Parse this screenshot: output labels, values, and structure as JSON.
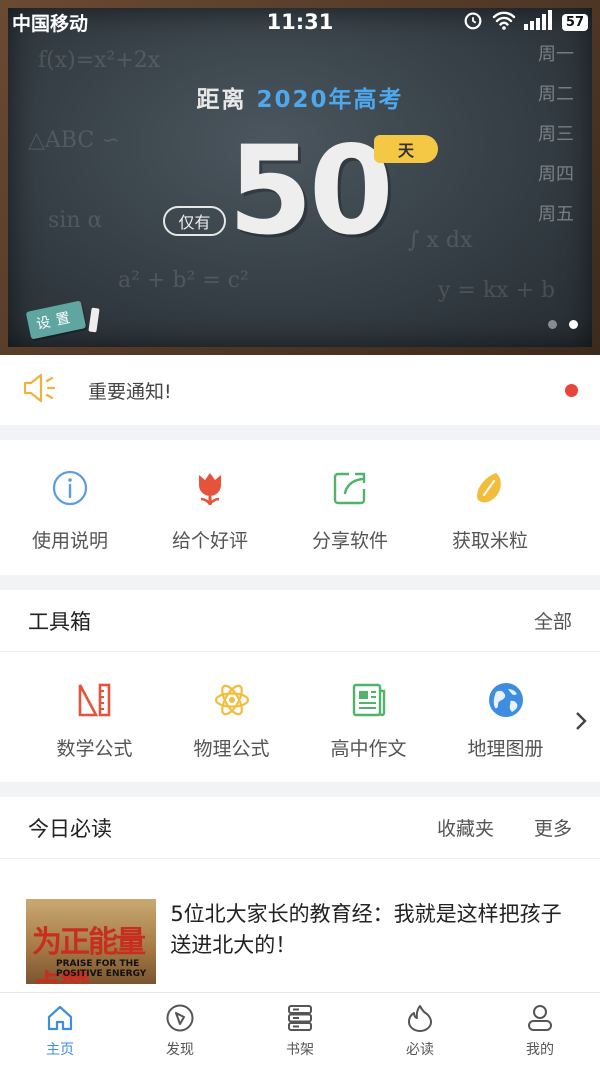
{
  "status_bar": {
    "carrier": "中国移动",
    "time": "11:31",
    "battery": "57"
  },
  "banner": {
    "title_prefix": "距离",
    "title_highlight": "2020年高考",
    "only_label": "仅有",
    "days": "50",
    "unit": "天",
    "settings_label": "设置",
    "weekdays": [
      "周一",
      "周二",
      "周三",
      "周四",
      "周五"
    ]
  },
  "notice": {
    "text": "重要通知!"
  },
  "quick_actions": [
    {
      "label": "使用说明",
      "icon": "info-icon"
    },
    {
      "label": "给个好评",
      "icon": "tulip-icon"
    },
    {
      "label": "分享软件",
      "icon": "share-icon"
    },
    {
      "label": "获取米粒",
      "icon": "rice-grain-icon"
    }
  ],
  "toolbox": {
    "title": "工具箱",
    "more": "全部",
    "items": [
      {
        "label": "数学公式",
        "icon": "ruler-icon"
      },
      {
        "label": "物理公式",
        "icon": "atom-icon"
      },
      {
        "label": "高中作文",
        "icon": "newspaper-icon"
      },
      {
        "label": "地理图册",
        "icon": "globe-icon"
      }
    ]
  },
  "daily": {
    "title": "今日必读",
    "favorites": "收藏夹",
    "more": "更多",
    "article": {
      "title": "5位北大家长的教育经：我就是这样把孩子送进北大的！",
      "thumb_text": "为正能量点赞",
      "thumb_caption": "PRAISE FOR THE POSITIVE ENERGY"
    }
  },
  "tabs": [
    {
      "label": "主页",
      "icon": "home-icon",
      "active": true
    },
    {
      "label": "发现",
      "icon": "compass-icon",
      "active": false
    },
    {
      "label": "书架",
      "icon": "bookshelf-icon",
      "active": false
    },
    {
      "label": "必读",
      "icon": "flame-icon",
      "active": false
    },
    {
      "label": "我的",
      "icon": "user-icon",
      "active": false
    }
  ],
  "colors": {
    "accent": "#3d8de0",
    "notice_dot": "#e8433c",
    "day_tag": "#f4c845"
  }
}
